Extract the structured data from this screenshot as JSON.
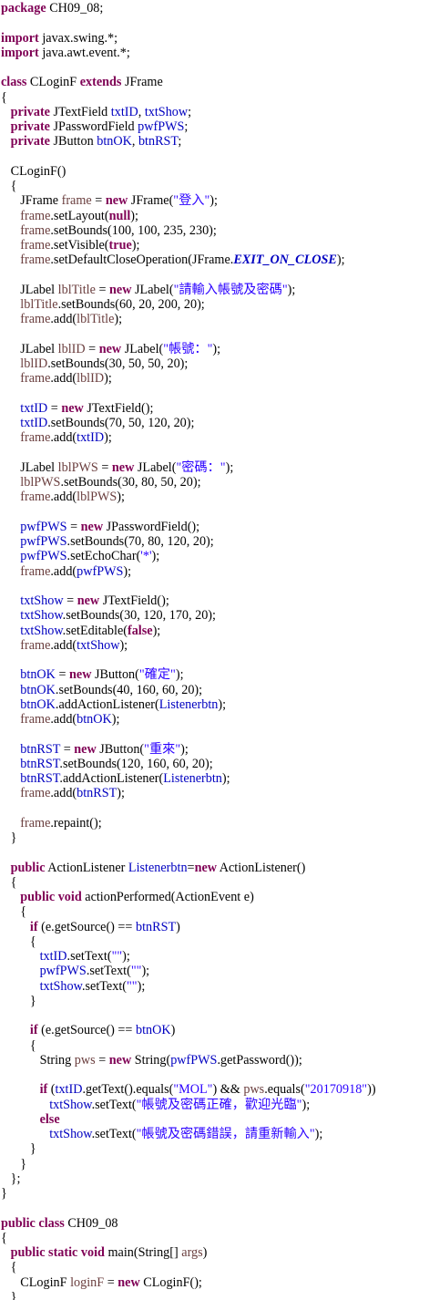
{
  "editor": {
    "language": "java",
    "token_colors": {
      "keyword": "#7f0055",
      "field": "#0000c0",
      "string": "#2a00ff",
      "local_variable": "#6a3e3e",
      "plain": "#000000",
      "background": "#ffffff"
    },
    "lines": [
      [
        {
          "t": "package",
          "k": "kw"
        },
        {
          "t": " CH09_08;"
        }
      ],
      [],
      [
        {
          "t": "import",
          "k": "kw"
        },
        {
          "t": " javax.swing.*;"
        }
      ],
      [
        {
          "t": "import",
          "k": "kw"
        },
        {
          "t": " java.awt.event.*;"
        }
      ],
      [],
      [
        {
          "t": "class",
          "k": "kw"
        },
        {
          "t": " CLoginF "
        },
        {
          "t": "extends",
          "k": "kw"
        },
        {
          "t": " JFrame"
        }
      ],
      [
        {
          "t": "{"
        }
      ],
      [
        {
          "t": "   "
        },
        {
          "t": "private",
          "k": "kw"
        },
        {
          "t": " JTextField "
        },
        {
          "t": "txtID",
          "k": "fld"
        },
        {
          "t": ", "
        },
        {
          "t": "txtShow",
          "k": "fld"
        },
        {
          "t": ";"
        }
      ],
      [
        {
          "t": "   "
        },
        {
          "t": "private",
          "k": "kw"
        },
        {
          "t": " JPasswordField "
        },
        {
          "t": "pwfPWS",
          "k": "fld"
        },
        {
          "t": ";"
        }
      ],
      [
        {
          "t": "   "
        },
        {
          "t": "private",
          "k": "kw"
        },
        {
          "t": " JButton "
        },
        {
          "t": "btnOK",
          "k": "fld"
        },
        {
          "t": ", "
        },
        {
          "t": "btnRST",
          "k": "fld"
        },
        {
          "t": ";"
        }
      ],
      [],
      [
        {
          "t": "   CLoginF()"
        }
      ],
      [
        {
          "t": "   {"
        }
      ],
      [
        {
          "t": "      JFrame "
        },
        {
          "t": "frame",
          "k": "var"
        },
        {
          "t": " = "
        },
        {
          "t": "new",
          "k": "kw"
        },
        {
          "t": " JFrame("
        },
        {
          "t": "\"登入\"",
          "k": "str"
        },
        {
          "t": ");"
        }
      ],
      [
        {
          "t": "      "
        },
        {
          "t": "frame",
          "k": "var"
        },
        {
          "t": ".setLayout("
        },
        {
          "t": "null",
          "k": "kw"
        },
        {
          "t": ");"
        }
      ],
      [
        {
          "t": "      "
        },
        {
          "t": "frame",
          "k": "var"
        },
        {
          "t": ".setBounds(100, 100, 235, 230);"
        }
      ],
      [
        {
          "t": "      "
        },
        {
          "t": "frame",
          "k": "var"
        },
        {
          "t": ".setVisible("
        },
        {
          "t": "true",
          "k": "kw"
        },
        {
          "t": ");"
        }
      ],
      [
        {
          "t": "      "
        },
        {
          "t": "frame",
          "k": "var"
        },
        {
          "t": ".setDefaultCloseOperation(JFrame."
        },
        {
          "t": "EXIT_ON_CLOSE",
          "k": "sfld"
        },
        {
          "t": ");"
        }
      ],
      [],
      [
        {
          "t": "      JLabel "
        },
        {
          "t": "lblTitle",
          "k": "var"
        },
        {
          "t": " = "
        },
        {
          "t": "new",
          "k": "kw"
        },
        {
          "t": " JLabel("
        },
        {
          "t": "\"請輸入帳號及密碼\"",
          "k": "str"
        },
        {
          "t": ");"
        }
      ],
      [
        {
          "t": "      "
        },
        {
          "t": "lblTitle",
          "k": "var"
        },
        {
          "t": ".setBounds(60, 20, 200, 20);"
        }
      ],
      [
        {
          "t": "      "
        },
        {
          "t": "frame",
          "k": "var"
        },
        {
          "t": ".add("
        },
        {
          "t": "lblTitle",
          "k": "var"
        },
        {
          "t": ");"
        }
      ],
      [],
      [
        {
          "t": "      JLabel "
        },
        {
          "t": "lblID",
          "k": "var"
        },
        {
          "t": " = "
        },
        {
          "t": "new",
          "k": "kw"
        },
        {
          "t": " JLabel("
        },
        {
          "t": "\"帳號：\"",
          "k": "str"
        },
        {
          "t": ");"
        }
      ],
      [
        {
          "t": "      "
        },
        {
          "t": "lblID",
          "k": "var"
        },
        {
          "t": ".setBounds(30, 50, 50, 20);"
        }
      ],
      [
        {
          "t": "      "
        },
        {
          "t": "frame",
          "k": "var"
        },
        {
          "t": ".add("
        },
        {
          "t": "lblID",
          "k": "var"
        },
        {
          "t": ");"
        }
      ],
      [],
      [
        {
          "t": "      "
        },
        {
          "t": "txtID",
          "k": "fld"
        },
        {
          "t": " = "
        },
        {
          "t": "new",
          "k": "kw"
        },
        {
          "t": " JTextField();"
        }
      ],
      [
        {
          "t": "      "
        },
        {
          "t": "txtID",
          "k": "fld"
        },
        {
          "t": ".setBounds(70, 50, 120, 20);"
        }
      ],
      [
        {
          "t": "      "
        },
        {
          "t": "frame",
          "k": "var"
        },
        {
          "t": ".add("
        },
        {
          "t": "txtID",
          "k": "fld"
        },
        {
          "t": ");"
        }
      ],
      [],
      [
        {
          "t": "      JLabel "
        },
        {
          "t": "lblPWS",
          "k": "var"
        },
        {
          "t": " = "
        },
        {
          "t": "new",
          "k": "kw"
        },
        {
          "t": " JLabel("
        },
        {
          "t": "\"密碼：\"",
          "k": "str"
        },
        {
          "t": ");"
        }
      ],
      [
        {
          "t": "      "
        },
        {
          "t": "lblPWS",
          "k": "var"
        },
        {
          "t": ".setBounds(30, 80, 50, 20);"
        }
      ],
      [
        {
          "t": "      "
        },
        {
          "t": "frame",
          "k": "var"
        },
        {
          "t": ".add("
        },
        {
          "t": "lblPWS",
          "k": "var"
        },
        {
          "t": ");"
        }
      ],
      [],
      [
        {
          "t": "      "
        },
        {
          "t": "pwfPWS",
          "k": "fld"
        },
        {
          "t": " = "
        },
        {
          "t": "new",
          "k": "kw"
        },
        {
          "t": " JPasswordField();"
        }
      ],
      [
        {
          "t": "      "
        },
        {
          "t": "pwfPWS",
          "k": "fld"
        },
        {
          "t": ".setBounds(70, 80, 120, 20);"
        }
      ],
      [
        {
          "t": "      "
        },
        {
          "t": "pwfPWS",
          "k": "fld"
        },
        {
          "t": ".setEchoChar("
        },
        {
          "t": "'*'",
          "k": "str"
        },
        {
          "t": ");"
        }
      ],
      [
        {
          "t": "      "
        },
        {
          "t": "frame",
          "k": "var"
        },
        {
          "t": ".add("
        },
        {
          "t": "pwfPWS",
          "k": "fld"
        },
        {
          "t": ");"
        }
      ],
      [],
      [
        {
          "t": "      "
        },
        {
          "t": "txtShow",
          "k": "fld"
        },
        {
          "t": " = "
        },
        {
          "t": "new",
          "k": "kw"
        },
        {
          "t": " JTextField();"
        }
      ],
      [
        {
          "t": "      "
        },
        {
          "t": "txtShow",
          "k": "fld"
        },
        {
          "t": ".setBounds(30, 120, 170, 20);"
        }
      ],
      [
        {
          "t": "      "
        },
        {
          "t": "txtShow",
          "k": "fld"
        },
        {
          "t": ".setEditable("
        },
        {
          "t": "false",
          "k": "kw"
        },
        {
          "t": ");"
        }
      ],
      [
        {
          "t": "      "
        },
        {
          "t": "frame",
          "k": "var"
        },
        {
          "t": ".add("
        },
        {
          "t": "txtShow",
          "k": "fld"
        },
        {
          "t": ");"
        }
      ],
      [],
      [
        {
          "t": "      "
        },
        {
          "t": "btnOK",
          "k": "fld"
        },
        {
          "t": " = "
        },
        {
          "t": "new",
          "k": "kw"
        },
        {
          "t": " JButton("
        },
        {
          "t": "\"確定\"",
          "k": "str"
        },
        {
          "t": ");"
        }
      ],
      [
        {
          "t": "      "
        },
        {
          "t": "btnOK",
          "k": "fld"
        },
        {
          "t": ".setBounds(40, 160, 60, 20);"
        }
      ],
      [
        {
          "t": "      "
        },
        {
          "t": "btnOK",
          "k": "fld"
        },
        {
          "t": ".addActionListener("
        },
        {
          "t": "Listenerbtn",
          "k": "fld"
        },
        {
          "t": ");"
        }
      ],
      [
        {
          "t": "      "
        },
        {
          "t": "frame",
          "k": "var"
        },
        {
          "t": ".add("
        },
        {
          "t": "btnOK",
          "k": "fld"
        },
        {
          "t": ");"
        }
      ],
      [],
      [
        {
          "t": "      "
        },
        {
          "t": "btnRST",
          "k": "fld"
        },
        {
          "t": " = "
        },
        {
          "t": "new",
          "k": "kw"
        },
        {
          "t": " JButton("
        },
        {
          "t": "\"重來\"",
          "k": "str"
        },
        {
          "t": ");"
        }
      ],
      [
        {
          "t": "      "
        },
        {
          "t": "btnRST",
          "k": "fld"
        },
        {
          "t": ".setBounds(120, 160, 60, 20);"
        }
      ],
      [
        {
          "t": "      "
        },
        {
          "t": "btnRST",
          "k": "fld"
        },
        {
          "t": ".addActionListener("
        },
        {
          "t": "Listenerbtn",
          "k": "fld"
        },
        {
          "t": ");"
        }
      ],
      [
        {
          "t": "      "
        },
        {
          "t": "frame",
          "k": "var"
        },
        {
          "t": ".add("
        },
        {
          "t": "btnRST",
          "k": "fld"
        },
        {
          "t": ");"
        }
      ],
      [],
      [
        {
          "t": "      "
        },
        {
          "t": "frame",
          "k": "var"
        },
        {
          "t": ".repaint();"
        }
      ],
      [
        {
          "t": "   }"
        }
      ],
      [],
      [
        {
          "t": "   "
        },
        {
          "t": "public",
          "k": "kw"
        },
        {
          "t": " ActionListener "
        },
        {
          "t": "Listenerbtn",
          "k": "fld"
        },
        {
          "t": "="
        },
        {
          "t": "new",
          "k": "kw"
        },
        {
          "t": " ActionListener()"
        }
      ],
      [
        {
          "t": "   {"
        }
      ],
      [
        {
          "t": "      "
        },
        {
          "t": "public",
          "k": "kw"
        },
        {
          "t": " "
        },
        {
          "t": "void",
          "k": "kw"
        },
        {
          "t": " actionPerformed(ActionEvent e)"
        }
      ],
      [
        {
          "t": "      {"
        }
      ],
      [
        {
          "t": "         "
        },
        {
          "t": "if",
          "k": "kw"
        },
        {
          "t": " (e.getSource() == "
        },
        {
          "t": "btnRST",
          "k": "fld"
        },
        {
          "t": ")"
        }
      ],
      [
        {
          "t": "         {"
        }
      ],
      [
        {
          "t": "            "
        },
        {
          "t": "txtID",
          "k": "fld"
        },
        {
          "t": ".setText("
        },
        {
          "t": "\"\"",
          "k": "str"
        },
        {
          "t": ");"
        }
      ],
      [
        {
          "t": "            "
        },
        {
          "t": "pwfPWS",
          "k": "fld"
        },
        {
          "t": ".setText("
        },
        {
          "t": "\"\"",
          "k": "str"
        },
        {
          "t": ");"
        }
      ],
      [
        {
          "t": "            "
        },
        {
          "t": "txtShow",
          "k": "fld"
        },
        {
          "t": ".setText("
        },
        {
          "t": "\"\"",
          "k": "str"
        },
        {
          "t": ");"
        }
      ],
      [
        {
          "t": "         }"
        }
      ],
      [],
      [
        {
          "t": "         "
        },
        {
          "t": "if",
          "k": "kw"
        },
        {
          "t": " (e.getSource() == "
        },
        {
          "t": "btnOK",
          "k": "fld"
        },
        {
          "t": ")"
        }
      ],
      [
        {
          "t": "         {"
        }
      ],
      [
        {
          "t": "            String "
        },
        {
          "t": "pws",
          "k": "var"
        },
        {
          "t": " = "
        },
        {
          "t": "new",
          "k": "kw"
        },
        {
          "t": " String("
        },
        {
          "t": "pwfPWS",
          "k": "fld"
        },
        {
          "t": ".getPassword());"
        }
      ],
      [],
      [
        {
          "t": "            "
        },
        {
          "t": "if",
          "k": "kw"
        },
        {
          "t": " ("
        },
        {
          "t": "txtID",
          "k": "fld"
        },
        {
          "t": ".getText().equals("
        },
        {
          "t": "\"MOL\"",
          "k": "str"
        },
        {
          "t": ") && "
        },
        {
          "t": "pws",
          "k": "var"
        },
        {
          "t": ".equals("
        },
        {
          "t": "\"20170918\"",
          "k": "str"
        },
        {
          "t": "))"
        }
      ],
      [
        {
          "t": "               "
        },
        {
          "t": "txtShow",
          "k": "fld"
        },
        {
          "t": ".setText("
        },
        {
          "t": "\"帳號及密碼正確，歡迎光臨\"",
          "k": "str"
        },
        {
          "t": ");"
        }
      ],
      [
        {
          "t": "            "
        },
        {
          "t": "else",
          "k": "kw"
        }
      ],
      [
        {
          "t": "               "
        },
        {
          "t": "txtShow",
          "k": "fld"
        },
        {
          "t": ".setText("
        },
        {
          "t": "\"帳號及密碼錯誤，請重新輸入\"",
          "k": "str"
        },
        {
          "t": ");"
        }
      ],
      [
        {
          "t": "         }"
        }
      ],
      [
        {
          "t": "      }"
        }
      ],
      [
        {
          "t": "   };"
        }
      ],
      [
        {
          "t": "}"
        }
      ],
      [],
      [
        {
          "t": "public",
          "k": "kw"
        },
        {
          "t": " "
        },
        {
          "t": "class",
          "k": "kw"
        },
        {
          "t": " CH09_08"
        }
      ],
      [
        {
          "t": "{"
        }
      ],
      [
        {
          "t": "   "
        },
        {
          "t": "public",
          "k": "kw"
        },
        {
          "t": " "
        },
        {
          "t": "static",
          "k": "kw"
        },
        {
          "t": " "
        },
        {
          "t": "void",
          "k": "kw"
        },
        {
          "t": " main(String[] "
        },
        {
          "t": "args",
          "k": "var"
        },
        {
          "t": ")"
        }
      ],
      [
        {
          "t": "   {"
        }
      ],
      [
        {
          "t": "      CLoginF "
        },
        {
          "t": "loginF",
          "k": "var"
        },
        {
          "t": " = "
        },
        {
          "t": "new",
          "k": "kw"
        },
        {
          "t": " CLoginF();"
        }
      ],
      [
        {
          "t": "   }"
        }
      ],
      [
        {
          "t": "}"
        }
      ]
    ]
  }
}
